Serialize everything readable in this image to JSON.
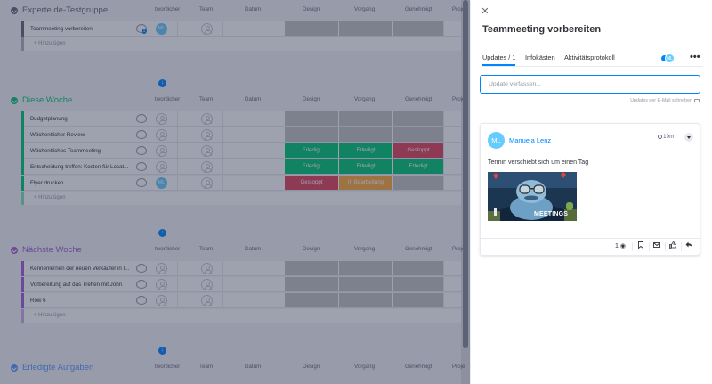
{
  "colors": {
    "accent": "#0085ff",
    "green_group": "#00c875",
    "purple_group": "#a25ddc",
    "blue_group": "#579bfc",
    "done": "#00c875",
    "stuck": "#e2445c",
    "working": "#fdab3d",
    "avatar": "#66ccff"
  },
  "columns": {
    "owner": "Verantwortlicher",
    "owner_visible": "twortlicher",
    "team": "Team",
    "date": "Datum",
    "design": "Design",
    "process": "Vorgang",
    "approved": "Genehmigt",
    "project": "Proje"
  },
  "add_label": "+ Hinzufügen",
  "groups": [
    {
      "title": "Experte de-Testgruppe",
      "color": "#676879",
      "rows": [
        {
          "name": "Teammeeting vorbereiten",
          "owner": "ML",
          "updates": "1",
          "design": "",
          "process": "",
          "approved": ""
        }
      ]
    },
    {
      "title": "Diese Woche",
      "color": "#00c875",
      "rows": [
        {
          "name": "Budgetplanung",
          "owner": "",
          "design": "",
          "process": "",
          "approved": ""
        },
        {
          "name": "Wöchentlicher Review",
          "owner": "",
          "design": "",
          "process": "",
          "approved": ""
        },
        {
          "name": "Wöchentliches Teammeeting",
          "owner": "",
          "design": "Erledigt",
          "process": "Erledigt",
          "approved": "Gestoppt"
        },
        {
          "name": "Entscheidung treffen: Kosten für Locat...",
          "owner": "",
          "design": "Erledigt",
          "process": "Erledigt",
          "approved": "Erledigt"
        },
        {
          "name": "Flyer drucken",
          "owner": "ML",
          "design": "Gestoppt",
          "process": "In Bearbeitung",
          "approved": ""
        }
      ]
    },
    {
      "title": "Nächste Woche",
      "color": "#a25ddc",
      "rows": [
        {
          "name": "Kennenlernen der neuen Verkäufer in I...",
          "owner": "",
          "design": "",
          "process": "",
          "approved": ""
        },
        {
          "name": "Vorbereitung auf das Treffen mit John",
          "owner": "",
          "design": "",
          "process": "",
          "approved": ""
        },
        {
          "name": "Row 6",
          "owner": "",
          "design": "",
          "process": "",
          "approved": ""
        }
      ]
    },
    {
      "title": "Erledigte Aufgaben",
      "color": "#579bfc",
      "rows": []
    }
  ],
  "panel": {
    "title": "Teammeeting vorbereiten",
    "tabs": [
      "Updates / 1",
      "Infokästen",
      "Aktivitätsprotokoll"
    ],
    "subscriber_initials": "ML",
    "composer_placeholder": "Update verfassen...",
    "email_hint": "Updates per E-Mail schreiben",
    "post": {
      "author_initials": "ML",
      "author": "Manuela Lenz",
      "time": "19m",
      "text": "Termin verschiebt sich um einen Tag",
      "gif_caption": "MEETINGS",
      "seen_count": "1"
    }
  }
}
